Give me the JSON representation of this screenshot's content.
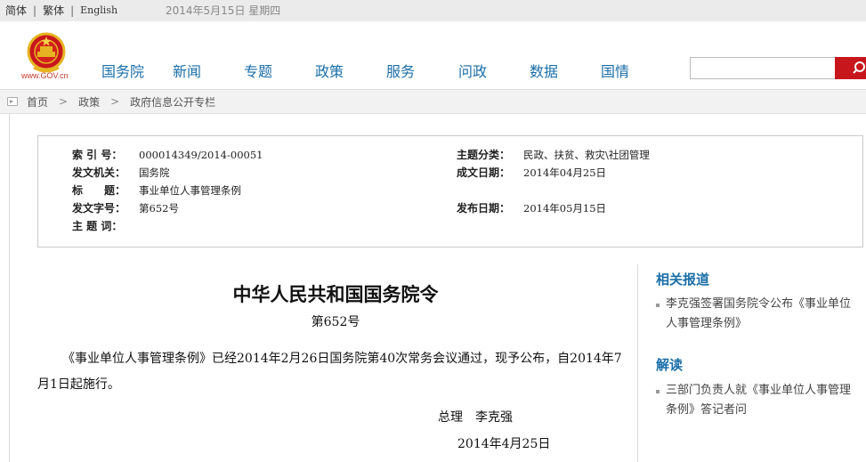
{
  "topbar": {
    "lang_simplified": "简体",
    "lang_traditional": "繁体",
    "lang_english": "English",
    "date": "2014年5月15日  星期四"
  },
  "header": {
    "logo_text": "www.GOV.cn",
    "nav": [
      "国务院",
      "新闻",
      "专题",
      "政策",
      "服务",
      "问政",
      "数据",
      "国情"
    ],
    "search": {
      "value": "",
      "placeholder": ""
    },
    "colors": {
      "nav": "#1a6ea8",
      "search_button": "#c8161d",
      "logo": "#c0392b"
    }
  },
  "breadcrumb": [
    "首页",
    "政策",
    "政府信息公开专栏"
  ],
  "info": {
    "index_no_label": "索 引 号：",
    "index_no": "000014349/2014-00051",
    "category_label": "主题分类：",
    "category": "民政、扶贫、救灾\\社团管理",
    "issuer_label": "发文机关：",
    "issuer": "国务院",
    "written_label": "成文日期：",
    "written": "2014年04月25日",
    "title_label": "标　　题：",
    "title": "事业单位人事管理条例",
    "doc_no_label": "发文字号：",
    "doc_no": "第652号",
    "published_label": "发布日期：",
    "published": "2014年05月15日",
    "keywords_label": "主 题 词：",
    "keywords": ""
  },
  "article": {
    "title": "中华人民共和国国务院令",
    "order_no": "第652号",
    "body": "《事业单位人事管理条例》已经2014年2月26日国务院第40次常务会议通过，现予公布，自2014年7月1日起施行。",
    "signer": "总理　李克强",
    "date": "2014年4月25日"
  },
  "sidebar": {
    "related_heading": "相关报道",
    "related_items": [
      "李克强签署国务院令公布《事业单位人事管理条例》"
    ],
    "interpret_heading": "解读",
    "interpret_items": [
      "三部门负责人就《事业单位人事管理条例》答记者问"
    ]
  }
}
